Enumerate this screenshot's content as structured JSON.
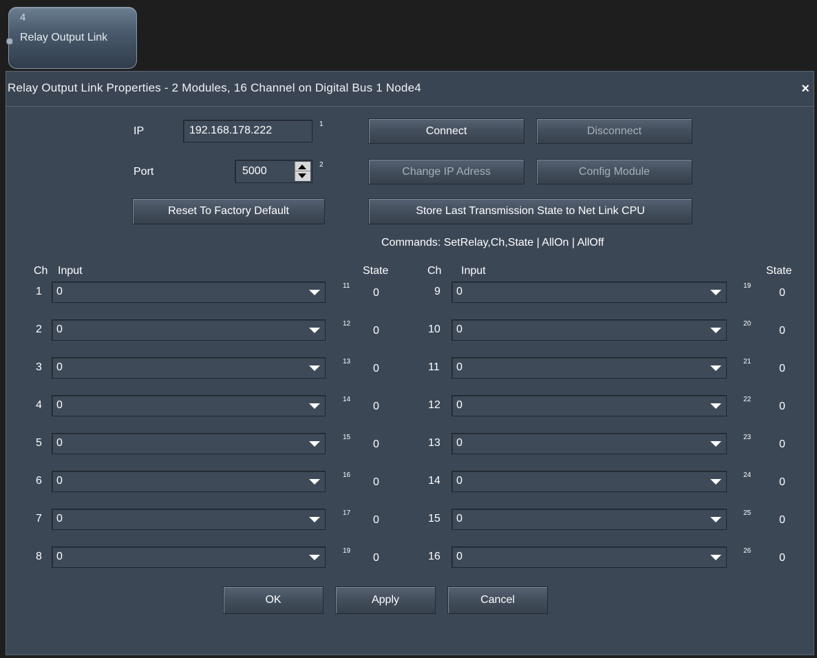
{
  "node": {
    "number": "4",
    "name": "Relay Output Link"
  },
  "dialog": {
    "title": "Relay Output Link Properties - 2 Modules, 16 Channel on Digital Bus 1 Node4",
    "close_label": "×",
    "ip_label": "IP",
    "ip_value": "192.168.178.222",
    "ip_pin": "1",
    "port_label": "Port",
    "port_value": "5000",
    "port_pin": "2",
    "connect": "Connect",
    "disconnect": "Disconnect",
    "change_ip": "Change IP Adress",
    "config_module": "Config Module",
    "reset_factory": "Reset To Factory Default",
    "store_state": "Store Last Transmission State to Net Link CPU",
    "commands": "Commands: SetRelay,Ch,State | AllOn | AllOff",
    "headers": {
      "ch": "Ch",
      "input": "Input",
      "state": "State"
    },
    "ok": "OK",
    "apply": "Apply",
    "cancel": "Cancel"
  },
  "channels_left": [
    {
      "ch": "1",
      "input": "0",
      "pin": "11",
      "state": "0"
    },
    {
      "ch": "2",
      "input": "0",
      "pin": "12",
      "state": "0"
    },
    {
      "ch": "3",
      "input": "0",
      "pin": "13",
      "state": "0"
    },
    {
      "ch": "4",
      "input": "0",
      "pin": "14",
      "state": "0"
    },
    {
      "ch": "5",
      "input": "0",
      "pin": "15",
      "state": "0"
    },
    {
      "ch": "6",
      "input": "0",
      "pin": "16",
      "state": "0"
    },
    {
      "ch": "7",
      "input": "0",
      "pin": "17",
      "state": "0"
    },
    {
      "ch": "8",
      "input": "0",
      "pin": "19",
      "state": "0"
    }
  ],
  "channels_right": [
    {
      "ch": "9",
      "input": "0",
      "pin": "19",
      "state": "0"
    },
    {
      "ch": "10",
      "input": "0",
      "pin": "20",
      "state": "0"
    },
    {
      "ch": "11",
      "input": "0",
      "pin": "21",
      "state": "0"
    },
    {
      "ch": "12",
      "input": "0",
      "pin": "22",
      "state": "0"
    },
    {
      "ch": "13",
      "input": "0",
      "pin": "23",
      "state": "0"
    },
    {
      "ch": "14",
      "input": "0",
      "pin": "24",
      "state": "0"
    },
    {
      "ch": "15",
      "input": "0",
      "pin": "25",
      "state": "0"
    },
    {
      "ch": "16",
      "input": "0",
      "pin": "26",
      "state": "0"
    }
  ]
}
